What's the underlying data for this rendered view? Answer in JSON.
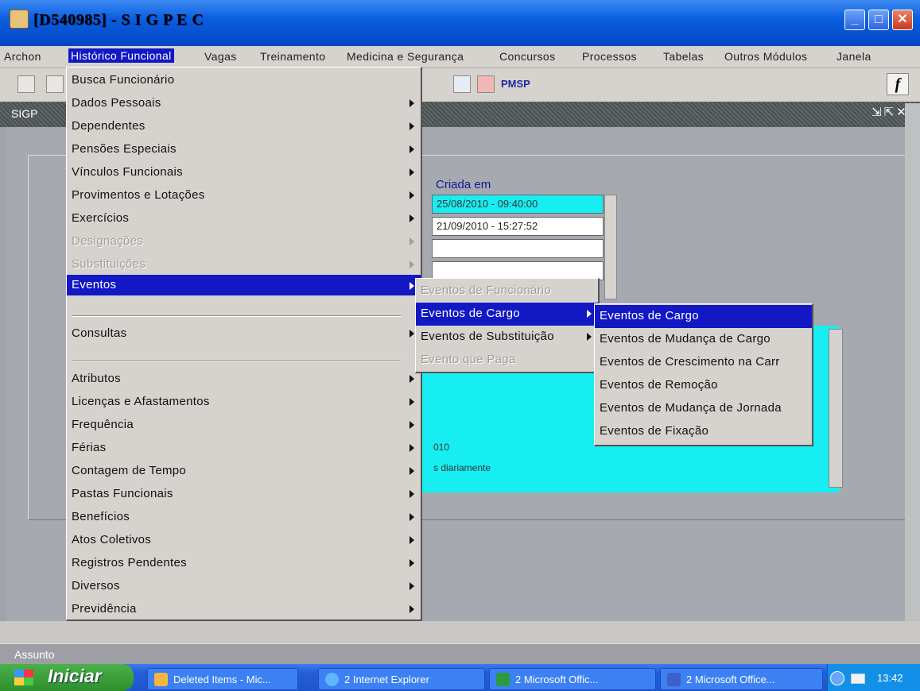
{
  "window": {
    "title": "[D540985] - S I G P E C"
  },
  "menubar": {
    "items": [
      "Archon",
      "Histórico Funcional",
      "Vagas",
      "Treinamento",
      "Medicina e Segurança",
      "Concursos",
      "Processos",
      "Tabelas",
      "Outros Módulos",
      "Janela"
    ]
  },
  "toolbar": {
    "pmsp_label": "PMSP",
    "fx_label": "f"
  },
  "inner_window": {
    "title": "SIGP"
  },
  "form": {
    "header_label": "Criada em",
    "row1_date": "25/08/2010  -  09:40:00",
    "row2_date": "21/09/2010  -  15:27:52",
    "note1": "010",
    "note2": "s diariamente"
  },
  "main_menu": {
    "items": [
      {
        "label": "Busca Funcionário",
        "submenu": false,
        "disabled": false
      },
      {
        "label": "Dados Pessoais",
        "submenu": true,
        "disabled": false
      },
      {
        "label": "Dependentes",
        "submenu": true,
        "disabled": false
      },
      {
        "label": "Pensões Especiais",
        "submenu": true,
        "disabled": false
      },
      {
        "label": "Vínculos Funcionais",
        "submenu": true,
        "disabled": false
      },
      {
        "label": "Provimentos e Lotações",
        "submenu": true,
        "disabled": false
      },
      {
        "label": "Exercícios",
        "submenu": true,
        "disabled": false
      },
      {
        "label": "Designações",
        "submenu": true,
        "disabled": true
      },
      {
        "label": "Substituições",
        "submenu": true,
        "disabled": true
      },
      {
        "label": "Eventos",
        "submenu": true,
        "disabled": false,
        "selected": true
      },
      {
        "label": "Consultas",
        "submenu": true,
        "disabled": false
      },
      {
        "label": "Atributos",
        "submenu": true,
        "disabled": false
      },
      {
        "label": "Licenças e Afastamentos",
        "submenu": true,
        "disabled": false
      },
      {
        "label": "Frequência",
        "submenu": true,
        "disabled": false
      },
      {
        "label": "Férias",
        "submenu": true,
        "disabled": false
      },
      {
        "label": "Contagem de Tempo",
        "submenu": true,
        "disabled": false
      },
      {
        "label": "Pastas Funcionais",
        "submenu": true,
        "disabled": false
      },
      {
        "label": "Benefícios",
        "submenu": true,
        "disabled": false
      },
      {
        "label": "Atos Coletivos",
        "submenu": true,
        "disabled": false
      },
      {
        "label": "Registros Pendentes",
        "submenu": true,
        "disabled": false
      },
      {
        "label": "Diversos",
        "submenu": true,
        "disabled": false
      },
      {
        "label": "Previdência",
        "submenu": true,
        "disabled": false
      }
    ]
  },
  "eventos_menu": {
    "items": [
      {
        "label": "Eventos de Funcionário",
        "submenu": false,
        "disabled": true
      },
      {
        "label": "Eventos de Cargo",
        "submenu": true,
        "disabled": false,
        "selected": true
      },
      {
        "label": "Eventos de Substituição",
        "submenu": true,
        "disabled": false
      },
      {
        "label": "Evento que Paga",
        "submenu": false,
        "disabled": true
      }
    ]
  },
  "cargo_menu": {
    "items": [
      {
        "label": "Eventos de Cargo",
        "selected": true
      },
      {
        "label": "Eventos de Mudança de Cargo"
      },
      {
        "label": "Eventos de Crescimento na Carr"
      },
      {
        "label": "Eventos de Remoção"
      },
      {
        "label": "Eventos de Mudança de Jornada"
      },
      {
        "label": "Eventos de Fixação"
      }
    ]
  },
  "status_bar": {
    "text": "Assunto"
  },
  "taskbar": {
    "start_label": "Iniciar",
    "tasks": [
      "Deleted Items - Mic...",
      "2 Internet Explorer",
      "2 Microsoft Offic...",
      "2 Microsoft Office..."
    ],
    "clock": "13:42"
  },
  "colors": {
    "menu_highlight": "#1218c4",
    "field_cyan": "#16eef2",
    "taskbar_blue": "#245edb",
    "start_green": "#2d8f2d"
  }
}
